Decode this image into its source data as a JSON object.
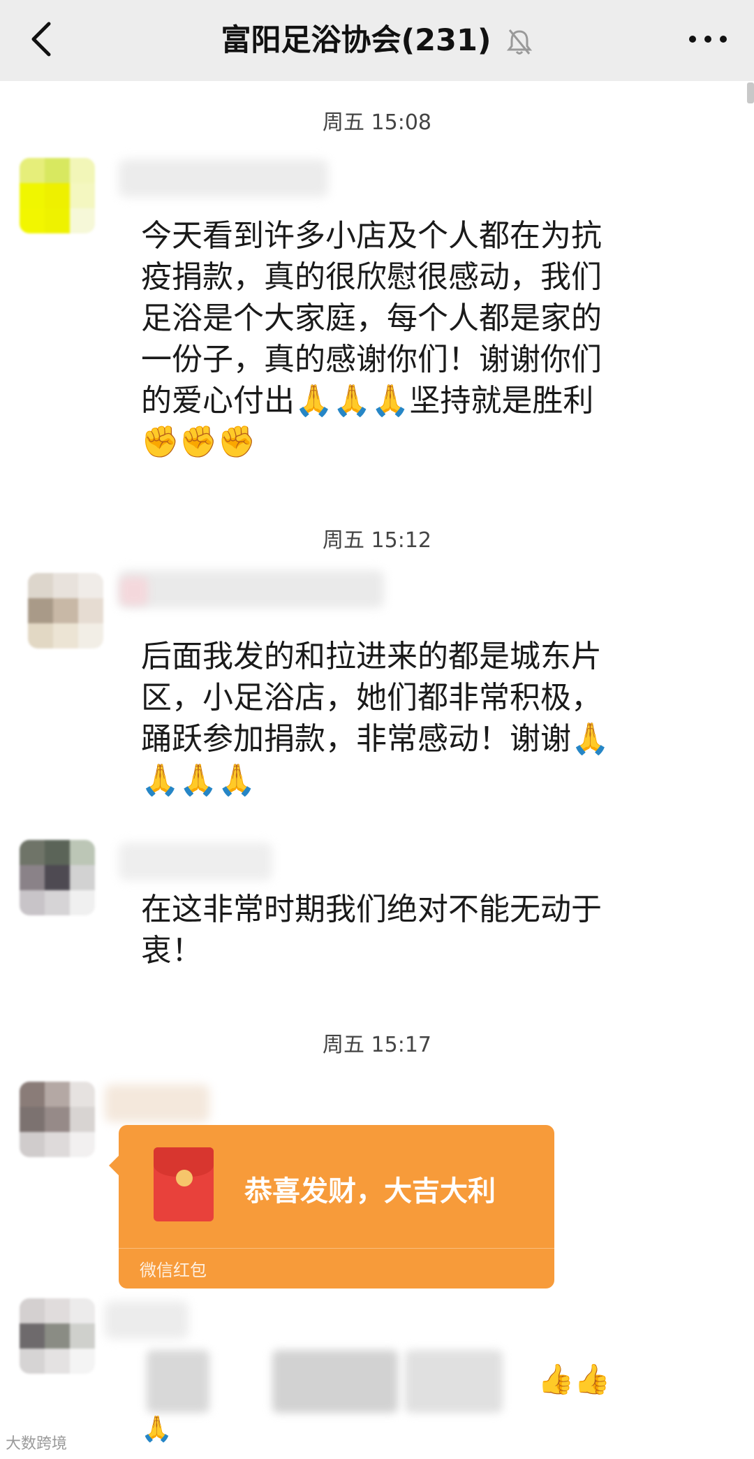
{
  "header": {
    "title": "富阳足浴协会(231)",
    "back_icon": "chevron-left-icon",
    "mute_icon": "bell-muted-icon",
    "more_icon": "more-dots-icon"
  },
  "messages": {
    "time1": "周五 15:08",
    "msg1": "今天看到许多小店及个人都在为抗\n疫捐款，真的很欣慰很感动，我们\n足浴是个大家庭，每个人都是家的\n一份子，真的感谢你们！谢谢你们\n的爱心付出🙏🙏🙏坚持就是胜利\n✊✊✊",
    "time2": "周五 15:12",
    "msg2": "后面我发的和拉进来的都是城东片\n区，小足浴店，她们都非常积极，\n踊跃参加捐款，非常感动！谢谢🙏\n🙏🙏🙏",
    "msg3": "在这非常时期我们绝对不能无动于\n衷！",
    "time3": "周五 15:17",
    "msg5_emoji": "👍👍",
    "msg5_emoji2": "🙏"
  },
  "red_packet": {
    "title": "恭喜发财，大吉大利",
    "label": "微信红包"
  },
  "watermark": "大数跨境",
  "colors": {
    "header_bg": "#ededed",
    "red_packet": "#f79b3a",
    "red_packet_icon": "#e8413b"
  }
}
